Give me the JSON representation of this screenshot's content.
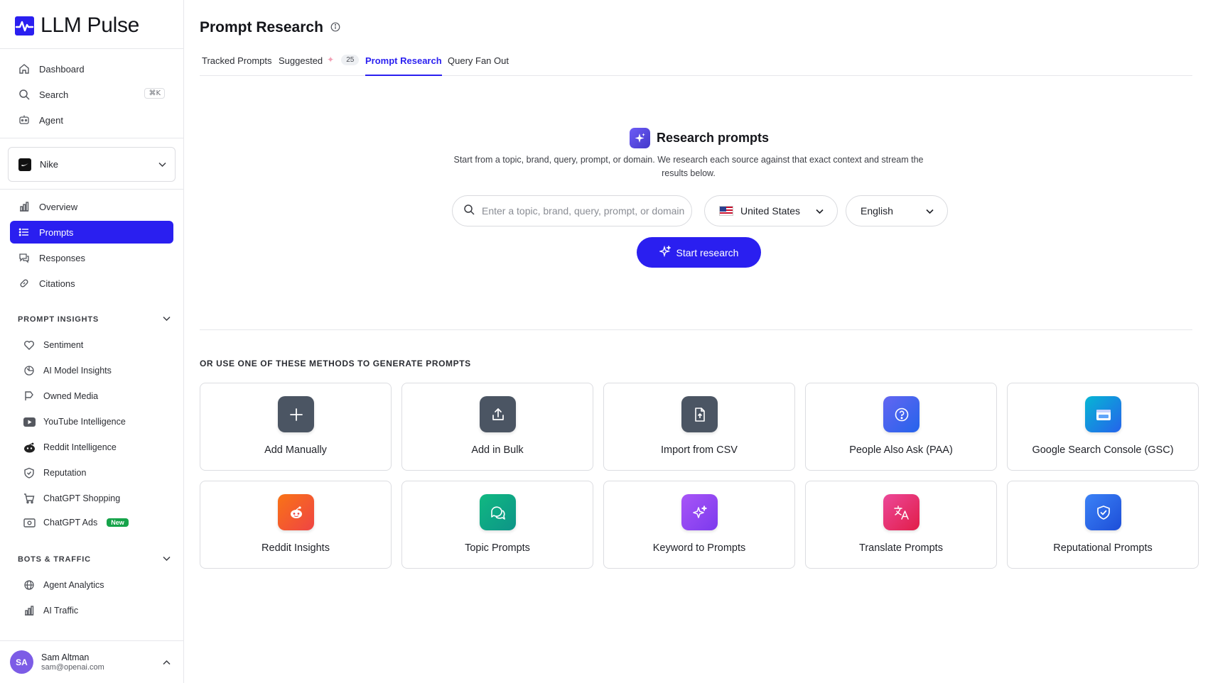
{
  "app": {
    "name": "LLM Pulse"
  },
  "sidebar": {
    "top_items": [
      {
        "label": "Dashboard",
        "icon": "home-icon"
      },
      {
        "label": "Search",
        "icon": "search-icon",
        "shortcut": "⌘K"
      },
      {
        "label": "Agent",
        "icon": "robot-icon"
      }
    ],
    "brand": {
      "name": "Nike",
      "icon": "nike-logo"
    },
    "main_items": [
      {
        "label": "Overview",
        "icon": "bar-chart-icon"
      },
      {
        "label": "Prompts",
        "icon": "list-icon",
        "active": true
      },
      {
        "label": "Responses",
        "icon": "chat-icon"
      },
      {
        "label": "Citations",
        "icon": "link-icon"
      }
    ],
    "prompt_insights": {
      "title": "PROMPT INSIGHTS",
      "items": [
        {
          "label": "Sentiment",
          "icon": "heart-icon"
        },
        {
          "label": "AI Model Insights",
          "icon": "model-icon"
        },
        {
          "label": "Owned Media",
          "icon": "flag-icon"
        },
        {
          "label": "YouTube Intelligence",
          "icon": "youtube-icon"
        },
        {
          "label": "Reddit Intelligence",
          "icon": "reddit-icon"
        },
        {
          "label": "Reputation",
          "icon": "shield-icon"
        },
        {
          "label": "ChatGPT Shopping",
          "icon": "cart-icon"
        },
        {
          "label": "ChatGPT Ads",
          "icon": "ads-icon",
          "badge": "New"
        }
      ]
    },
    "bots_traffic": {
      "title": "BOTS & TRAFFIC",
      "items": [
        {
          "label": "Agent Analytics",
          "icon": "globe-icon"
        },
        {
          "label": "AI Traffic",
          "icon": "bar-chart-icon"
        }
      ]
    },
    "user": {
      "initials": "SA",
      "name": "Sam Altman",
      "email": "sam@openai.com"
    }
  },
  "header": {
    "title": "Prompt Research",
    "tabs": [
      {
        "label": "Tracked Prompts"
      },
      {
        "label": "Suggested",
        "count": "25"
      },
      {
        "label": "Prompt Research",
        "active": true
      },
      {
        "label": "Query Fan Out"
      }
    ]
  },
  "research": {
    "title": "Research prompts",
    "description": "Start from a topic, brand, query, prompt, or domain. We research each source against that exact context and stream the results below.",
    "search_placeholder": "Enter a topic, brand, query, prompt, or domain",
    "country": "United States",
    "language": "English",
    "start_label": "Start research"
  },
  "methods": {
    "title": "OR USE ONE OF THESE METHODS TO GENERATE PROMPTS",
    "cards": [
      {
        "label": "Add Manually",
        "icon": "plus-icon",
        "color": "#4b5563"
      },
      {
        "label": "Add in Bulk",
        "icon": "upload-icon",
        "color": "#4b5563"
      },
      {
        "label": "Import from CSV",
        "icon": "file-upload-icon",
        "color": "#4b5563"
      },
      {
        "label": "People Also Ask (PAA)",
        "icon": "question-icon",
        "color": "#4f46e5"
      },
      {
        "label": "Google Search Console (GSC)",
        "icon": "browser-icon",
        "color": "#0ea5e9"
      },
      {
        "label": "Reddit Insights",
        "icon": "reddit-icon",
        "color": "#f97316"
      },
      {
        "label": "Topic Prompts",
        "icon": "chat-bubbles-icon",
        "color": "#10b981"
      },
      {
        "label": "Keyword to Prompts",
        "icon": "sparkles-icon",
        "color": "#8b5cf6"
      },
      {
        "label": "Translate Prompts",
        "icon": "translate-icon",
        "color": "#e11d48"
      },
      {
        "label": "Reputational Prompts",
        "icon": "shield-check-icon",
        "color": "#2563eb"
      }
    ]
  }
}
